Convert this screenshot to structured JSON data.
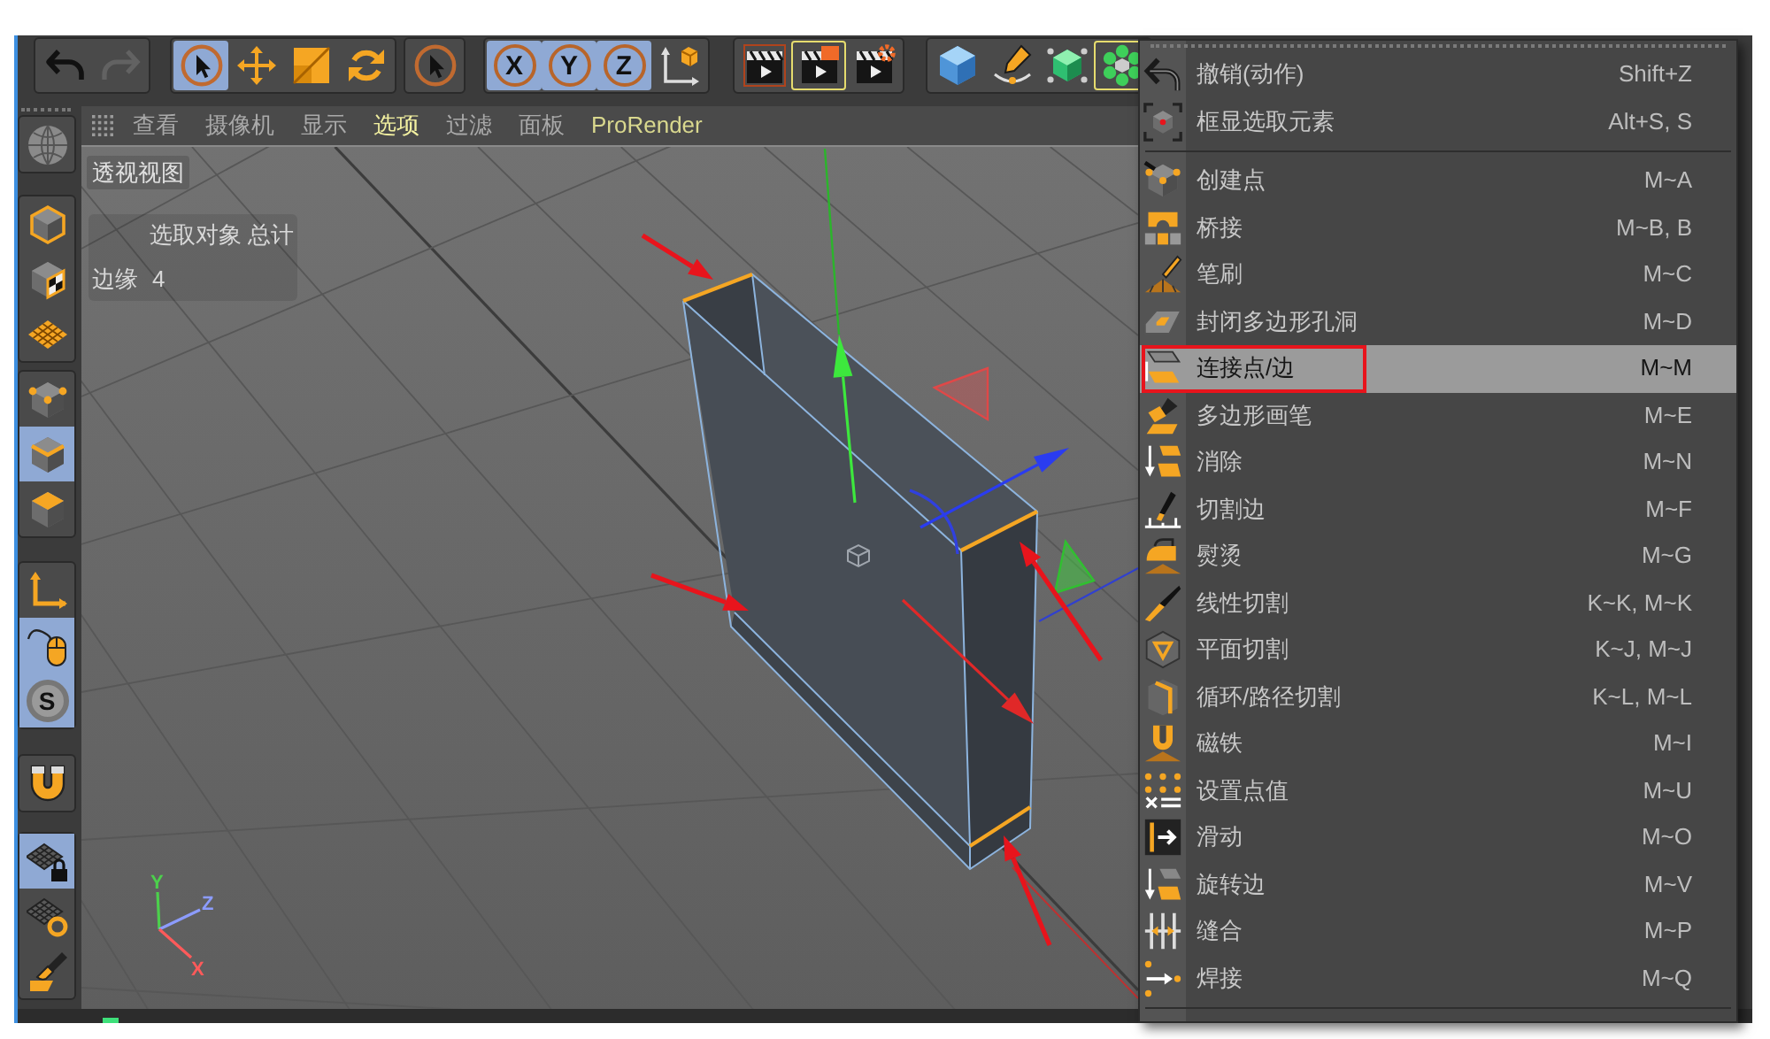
{
  "toolbar": {
    "groups": [
      [
        {
          "on": false,
          "highlighted": false,
          "disabled": false
        },
        {
          "on": false,
          "highlighted": false,
          "disabled": true
        }
      ],
      [
        {
          "on": true,
          "highlighted": false,
          "disabled": false
        },
        {
          "on": false,
          "highlighted": false,
          "disabled": false
        },
        {
          "on": false,
          "highlighted": false,
          "disabled": false
        },
        {
          "on": false,
          "highlighted": false,
          "disabled": false
        }
      ],
      [
        {
          "on": false,
          "highlighted": false,
          "disabled": false
        }
      ],
      [
        {
          "label": "X",
          "on": true,
          "highlighted": false,
          "disabled": false
        },
        {
          "label": "Y",
          "on": true,
          "highlighted": false,
          "disabled": false
        },
        {
          "label": "Z",
          "on": true,
          "highlighted": false,
          "disabled": false
        },
        {
          "on": false,
          "highlighted": false,
          "disabled": false
        }
      ],
      [
        {
          "on": false,
          "highlighted": false,
          "disabled": false
        },
        {
          "on": false,
          "highlighted": true,
          "disabled": false
        },
        {
          "on": false,
          "highlighted": false,
          "disabled": false
        }
      ],
      [
        {
          "on": false,
          "highlighted": false,
          "disabled": false
        },
        {
          "on": false,
          "highlighted": false,
          "disabled": false
        },
        {
          "on": false,
          "highlighted": false,
          "disabled": false
        },
        {
          "on": false,
          "highlighted": true,
          "disabled": false
        }
      ]
    ]
  },
  "left_toolbar": {
    "groups": [
      [
        {
          "on": false
        }
      ],
      [
        {
          "on": false
        },
        {
          "on": false
        },
        {
          "on": false
        }
      ],
      [
        {
          "on": false
        },
        {
          "on": true
        },
        {
          "on": false
        }
      ],
      [
        {
          "on": false
        },
        {
          "on": true
        },
        {
          "label": "S",
          "on": true
        }
      ],
      [
        {
          "on": false
        }
      ],
      [
        {
          "on": true
        },
        {
          "on": false
        },
        {
          "on": false
        }
      ]
    ]
  },
  "viewport": {
    "menu": [
      {
        "label": "查看",
        "kind": "menu",
        "selected": false
      },
      {
        "label": "摄像机",
        "kind": "menu",
        "selected": false
      },
      {
        "label": "显示",
        "kind": "menu",
        "selected": false
      },
      {
        "label": "选项",
        "kind": "menu",
        "selected": true
      },
      {
        "label": "过滤",
        "kind": "menu",
        "selected": false
      },
      {
        "label": "面板",
        "kind": "menu",
        "selected": false
      },
      {
        "label": "ProRender",
        "kind": "plugin",
        "selected": false
      }
    ],
    "view_label": "透视视图",
    "hud": {
      "header": "选取对象 总计",
      "rows": [
        {
          "label": "边缘",
          "value": "4"
        }
      ]
    },
    "world_axis": [
      {
        "label": "Y",
        "color": "#4cd04c"
      },
      {
        "label": "Z",
        "color": "#8c9cff"
      },
      {
        "label": "X",
        "color": "#ff5a5a"
      }
    ]
  },
  "context_menu": {
    "groups": [
      [
        {
          "label": "撤销(动作)",
          "shortcut": "Shift+Z",
          "selected": false
        },
        {
          "label": "框显选取元素",
          "shortcut": "Alt+S, S",
          "selected": false
        }
      ],
      [
        {
          "label": "创建点",
          "shortcut": "M~A",
          "selected": false
        },
        {
          "label": "桥接",
          "shortcut": "M~B, B",
          "selected": false
        },
        {
          "label": "笔刷",
          "shortcut": "M~C",
          "selected": false
        },
        {
          "label": "封闭多边形孔洞",
          "shortcut": "M~D",
          "selected": false
        },
        {
          "label": "连接点/边",
          "shortcut": "M~M",
          "selected": true
        },
        {
          "label": "多边形画笔",
          "shortcut": "M~E",
          "selected": false
        },
        {
          "label": "消除",
          "shortcut": "M~N",
          "selected": false
        },
        {
          "label": "切割边",
          "shortcut": "M~F",
          "selected": false
        },
        {
          "label": "熨烫",
          "shortcut": "M~G",
          "selected": false
        },
        {
          "label": "线性切割",
          "shortcut": "K~K, M~K",
          "selected": false
        },
        {
          "label": "平面切割",
          "shortcut": "K~J, M~J",
          "selected": false
        },
        {
          "label": "循环/路径切割",
          "shortcut": "K~L, M~L",
          "selected": false
        },
        {
          "label": "磁铁",
          "shortcut": "M~I",
          "selected": false
        },
        {
          "label": "设置点值",
          "shortcut": "M~U",
          "selected": false
        },
        {
          "label": "滑动",
          "shortcut": "M~O",
          "selected": false
        },
        {
          "label": "旋转边",
          "shortcut": "M~V",
          "selected": false
        },
        {
          "label": "缝合",
          "shortcut": "M~P",
          "selected": false
        },
        {
          "label": "焊接",
          "shortcut": "M~Q",
          "selected": false
        }
      ]
    ]
  }
}
